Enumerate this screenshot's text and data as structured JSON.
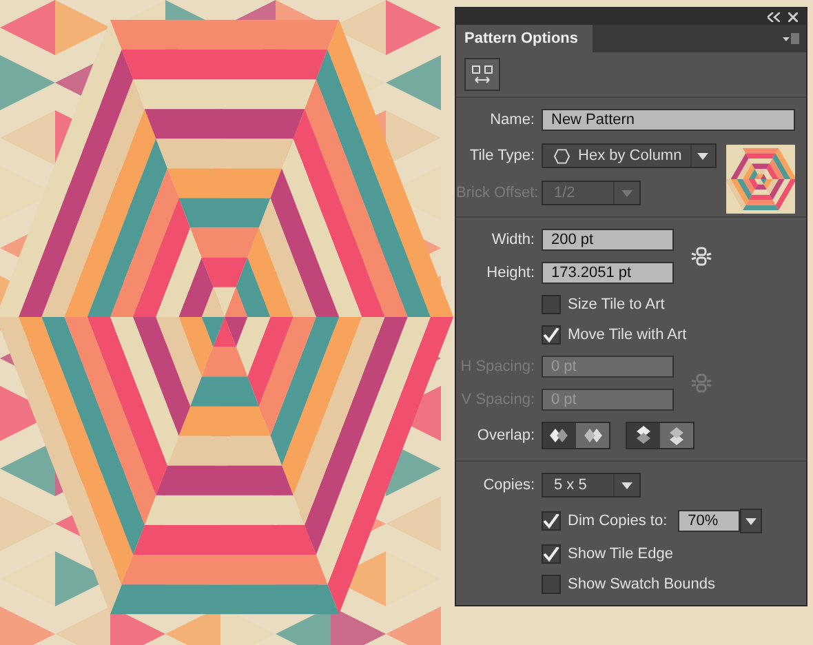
{
  "panel": {
    "title": "Pattern Options",
    "name": {
      "label": "Name:",
      "value": "New Pattern"
    },
    "tile_type": {
      "label": "Tile Type:",
      "value": "Hex by Column"
    },
    "brick_offset": {
      "label": "Brick Offset:",
      "value": "1/2",
      "disabled": true
    },
    "width": {
      "label": "Width:",
      "value": "200 pt"
    },
    "height": {
      "label": "Height:",
      "value": "173.2051 pt"
    },
    "size_linked": {
      "disabled": false
    },
    "checks_top": [
      {
        "label": "Size Tile to Art",
        "checked": false
      },
      {
        "label": "Move Tile with Art",
        "checked": true
      }
    ],
    "h_spacing": {
      "label": "H Spacing:",
      "value": "0 pt",
      "disabled": true
    },
    "v_spacing": {
      "label": "V Spacing:",
      "value": "0 pt",
      "disabled": true
    },
    "spacing_linked": {
      "disabled": true
    },
    "overlap": {
      "label": "Overlap:",
      "horizontal": [
        {
          "selected": true
        },
        {
          "selected": false
        }
      ],
      "vertical": [
        {
          "selected": true
        },
        {
          "selected": false
        }
      ]
    },
    "copies": {
      "label": "Copies:",
      "value": "5 x 5"
    },
    "dim_copies": {
      "label": "Dim Copies to:",
      "checked": true,
      "value": "70%"
    },
    "checks_bottom": [
      {
        "label": "Show Tile Edge",
        "checked": true
      },
      {
        "label": "Show Swatch Bounds",
        "checked": false
      }
    ]
  }
}
